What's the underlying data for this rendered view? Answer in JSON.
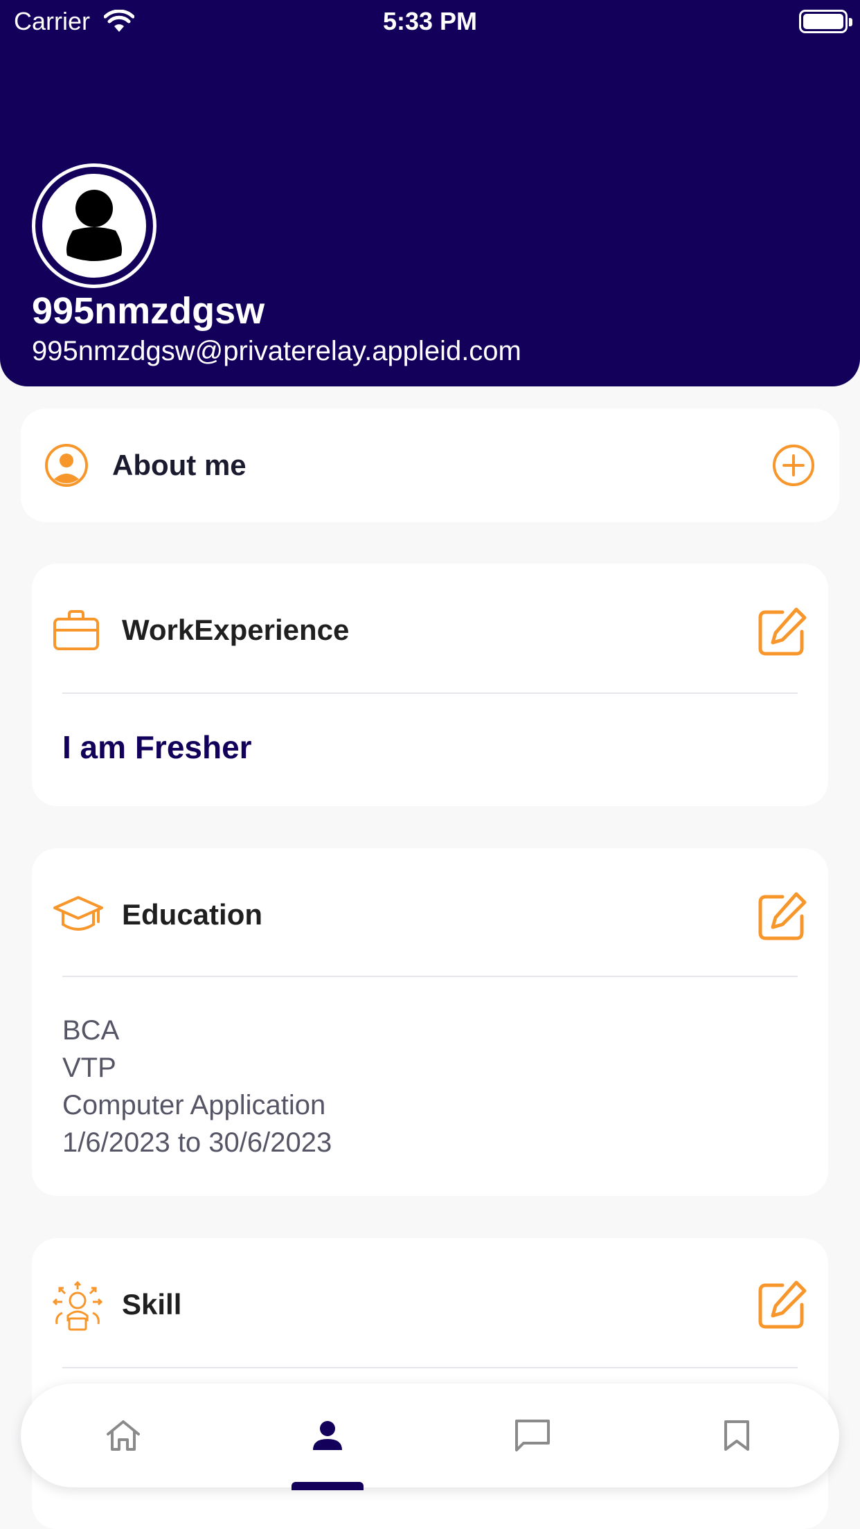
{
  "status_bar": {
    "carrier": "Carrier",
    "time": "5:33 PM"
  },
  "profile": {
    "username": "995nmzdgsw",
    "email": "995nmzdgsw@privaterelay.appleid.com"
  },
  "about": {
    "title": "About me"
  },
  "work": {
    "title": "WorkExperience",
    "value": "I am Fresher"
  },
  "education": {
    "title": "Education",
    "degree": "BCA",
    "institute": "VTP",
    "field": "Computer Application",
    "dates": "1/6/2023 to 30/6/2023"
  },
  "skill": {
    "title": "Skill"
  },
  "colors": {
    "primary": "#12005b",
    "accent": "#f7962b",
    "nav_inactive": "#8a8a8a"
  },
  "nav": {
    "items": [
      {
        "icon": "home-icon"
      },
      {
        "icon": "profile-icon",
        "active": true
      },
      {
        "icon": "chat-icon"
      },
      {
        "icon": "bookmark-icon"
      }
    ]
  }
}
